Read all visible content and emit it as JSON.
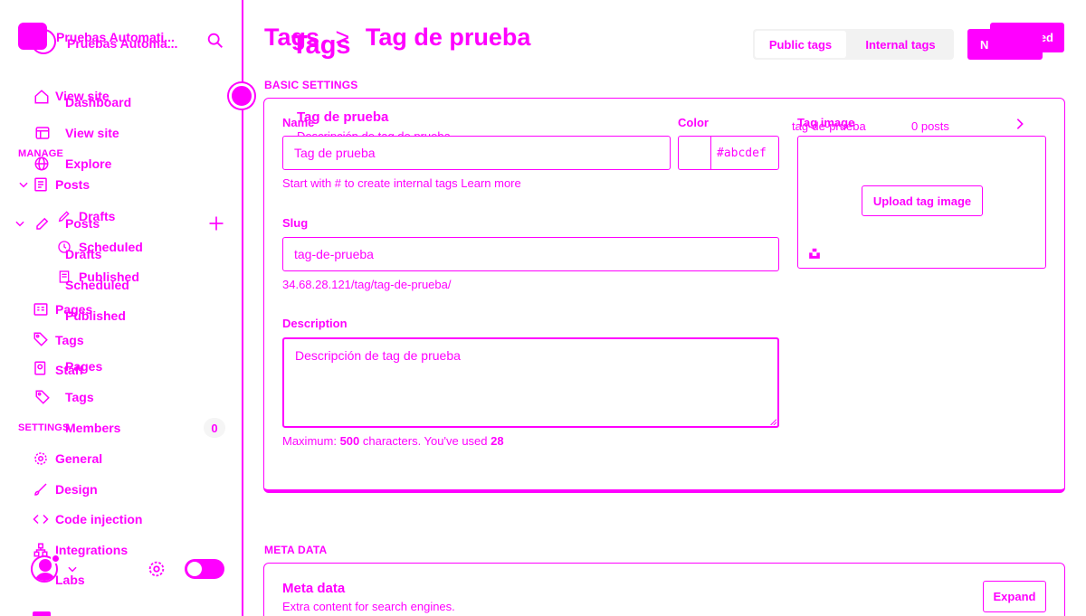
{
  "colors": {
    "accent": "#ff00ff",
    "background": "#ffffff"
  },
  "sidebar": {
    "site_title": "Pruebas Automati...",
    "site_title_ghost": "Pruebas Automa...",
    "view_site_ghost": "View site",
    "manage_label": "MANAGE",
    "settings_label": "SETTINGS",
    "items": [
      {
        "label": "Dashboard",
        "icon": "home-icon"
      },
      {
        "label": "View site",
        "icon": "window-icon"
      },
      {
        "label": "Explore",
        "icon": "globe-icon"
      },
      {
        "label": "Posts",
        "icon": "posts-icon"
      },
      {
        "label": "Drafts"
      },
      {
        "label": "Scheduled"
      },
      {
        "label": "Published"
      },
      {
        "label": "Pages"
      },
      {
        "label": "Tags"
      },
      {
        "label": "Members",
        "count": "0"
      }
    ],
    "ghost_items": {
      "posts": "Posts",
      "drafts": "Drafts",
      "scheduled": "Scheduled",
      "published": "Published",
      "pages": "Pages",
      "tags": "Tags",
      "staff": "Staff"
    },
    "settings_items": [
      {
        "label": "General",
        "icon": "gear-icon"
      },
      {
        "label": "Design",
        "icon": "brush-icon"
      },
      {
        "label": "Code injection",
        "icon": "code-icon"
      },
      {
        "label": "Integrations",
        "icon": "integrations-icon"
      },
      {
        "label": "Labs",
        "icon": "labs-icon"
      }
    ]
  },
  "header": {
    "breadcrumb_parent": "Tags",
    "breadcrumb_parent_ghost": "Tags",
    "breadcrumb_sep": ">",
    "title": "Tag de prueba",
    "tab_public": "Public tags",
    "tab_internal": "Internal tags",
    "new_button": "N",
    "saved_button": "ed"
  },
  "basic": {
    "section_label": "BASIC SETTINGS",
    "name_label": "Name",
    "name_value": "Tag de prueba",
    "preview_title": "Tag de prueba",
    "preview_desc": "Descripción de tag de prueba",
    "color_label": "Color",
    "color_value": "#abcdef",
    "name_hint": "Start with # to create internal tags Learn more",
    "slug_label": "Slug",
    "slug_value": "tag-de-prueba",
    "url_hint": "34.68.28.121/tag/tag-de-prueba/",
    "description_label": "Description",
    "description_value": "Descripción de tag de prueba",
    "max_prefix": "Maximum: ",
    "max_value": "500",
    "max_middle": " characters. You've used ",
    "used_value": "28",
    "tag_image_label": "Tag image",
    "tag_slug_ghost": "tag-de-prueba",
    "posts_count": "0 posts",
    "upload_button": "Upload tag image"
  },
  "meta": {
    "section_label": "META DATA",
    "title": "Meta data",
    "subtitle": "Extra content for search engines.",
    "expand_button": "Expand"
  }
}
